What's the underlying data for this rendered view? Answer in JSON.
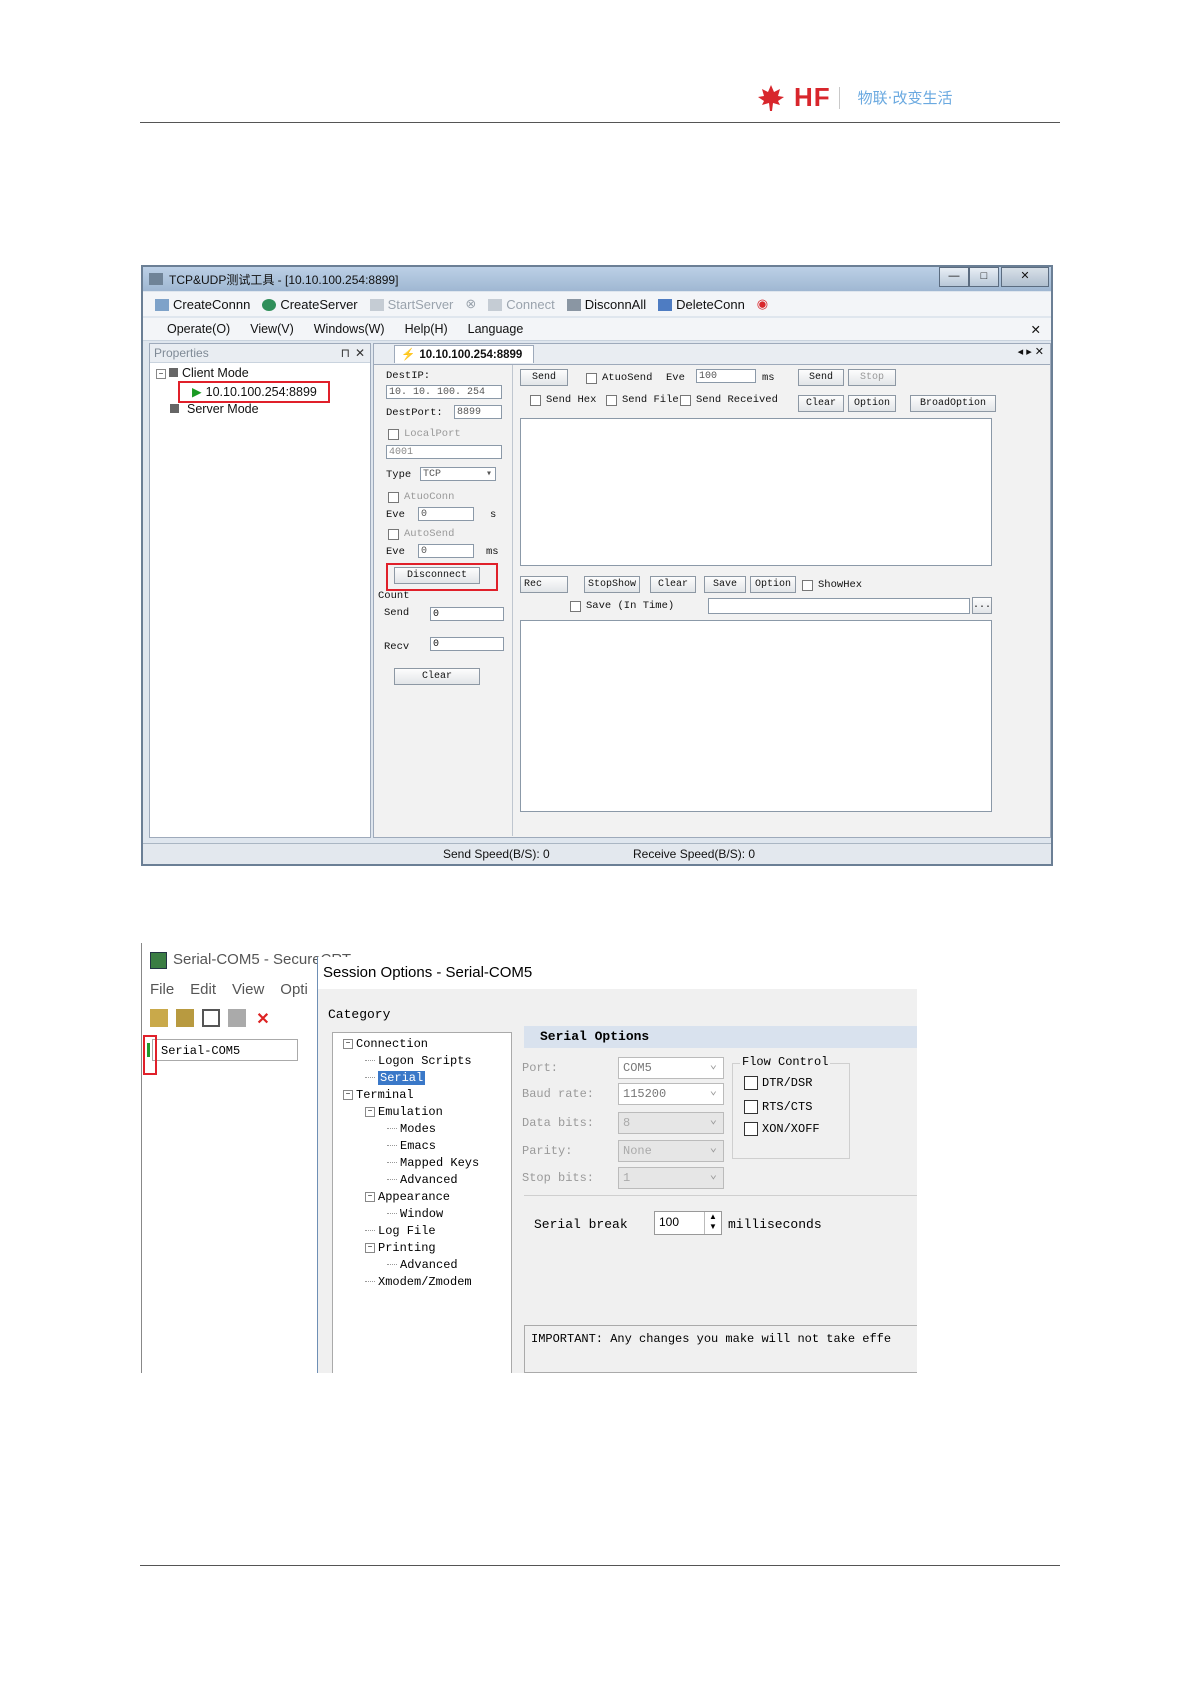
{
  "header": {
    "brand": "HF",
    "slogan": "物联·改变生活"
  },
  "tcp_tool": {
    "title": "TCP&UDP测试工具 - [10.10.100.254:8899]",
    "window_controls": [
      "—",
      "□",
      "✕"
    ],
    "toolbar": [
      "CreateConnn",
      "CreateServer",
      "StartServer",
      "Connect",
      "DisconnAll",
      "DeleteConn"
    ],
    "menu": [
      "Operate(O)",
      "View(V)",
      "Windows(W)",
      "Help(H)",
      "Language"
    ],
    "properties_label": "Properties",
    "tree": {
      "client_mode": "Client Mode",
      "connection": "10.10.100.254:8899",
      "server_mode": "Server Mode"
    },
    "tab_label": "10.10.100.254:8899",
    "left_panel": {
      "dest_ip_label": "DestIP:",
      "dest_ip_value": "10. 10. 100. 254",
      "dest_port_label": "DestPort:",
      "dest_port_value": "8899",
      "local_port_label": "LocalPort",
      "local_port_value": "4001",
      "type_label": "Type",
      "type_value": "TCP",
      "atuo_conn_label": "AtuoConn",
      "eve1_label": "Eve",
      "eve1_value": "0",
      "eve1_unit": "s",
      "auto_send_label": "AutoSend",
      "eve2_label": "Eve",
      "eve2_value": "0",
      "eve2_unit": "ms",
      "disconnect_button": "Disconnect",
      "count_label": "Count",
      "send_label": "Send",
      "send_value": "0",
      "recv_label": "Recv",
      "recv_value": "0",
      "clear_button": "Clear"
    },
    "send_bar": {
      "send_button": "Send",
      "atuo_send_label": "AtuoSend",
      "eve_label": "Eve",
      "eve_value": "100",
      "ms_label": "ms",
      "send2_button": "Send",
      "stop_button": "Stop",
      "send_hex_label": "Send Hex",
      "send_file_label": "Send File",
      "send_received_label": "Send Received",
      "clear_button": "Clear",
      "option_button": "Option",
      "broadcast_button": "BroadOption"
    },
    "recv_bar": {
      "rec_label": "Rec",
      "stopshow_button": "StopShow",
      "clear_button": "Clear",
      "save_button": "Save",
      "option_button": "Option",
      "showhex_label": "ShowHex",
      "save_realtime_label": "Save (In Time)",
      "browse_button": "..."
    },
    "status": {
      "send_speed": "Send Speed(B/S): 0",
      "receive_speed": "Receive Speed(B/S): 0"
    }
  },
  "securecrt": {
    "bg_title": "Serial-COM5 - SecureCRT",
    "bg_menu": [
      "File",
      "Edit",
      "View",
      "Opti"
    ],
    "bg_session_tab": "Serial-COM5",
    "dialog_title": "Session Options - Serial-COM5",
    "category_label": "Category",
    "tree": [
      {
        "label": "Connection",
        "level": 0,
        "expander": "-"
      },
      {
        "label": "Logon Scripts",
        "level": 1,
        "expander": ""
      },
      {
        "label": "Serial",
        "level": 1,
        "expander": "",
        "selected": true
      },
      {
        "label": "Terminal",
        "level": 0,
        "expander": "-"
      },
      {
        "label": "Emulation",
        "level": 1,
        "expander": "-"
      },
      {
        "label": "Modes",
        "level": 2,
        "expander": ""
      },
      {
        "label": "Emacs",
        "level": 2,
        "expander": ""
      },
      {
        "label": "Mapped Keys",
        "level": 2,
        "expander": ""
      },
      {
        "label": "Advanced",
        "level": 2,
        "expander": ""
      },
      {
        "label": "Appearance",
        "level": 1,
        "expander": "-"
      },
      {
        "label": "Window",
        "level": 2,
        "expander": ""
      },
      {
        "label": "Log File",
        "level": 1,
        "expander": ""
      },
      {
        "label": "Printing",
        "level": 1,
        "expander": "-"
      },
      {
        "label": "Advanced",
        "level": 2,
        "expander": ""
      },
      {
        "label": "Xmodem/Zmodem",
        "level": 1,
        "expander": ""
      }
    ],
    "serial_options_title": "Serial Options",
    "port_label": "Port:",
    "port_value": "COM5",
    "baud_label": "Baud rate:",
    "baud_value": "115200",
    "data_bits_label": "Data bits:",
    "data_bits_value": "8",
    "parity_label": "Parity:",
    "parity_value": "None",
    "stop_bits_label": "Stop bits:",
    "stop_bits_value": "1",
    "flow_control_label": "Flow Control",
    "flow_dtr": "DTR/DSR",
    "flow_rts": "RTS/CTS",
    "flow_xon": "XON/XOFF",
    "serial_break_label": "Serial break",
    "serial_break_value": "100",
    "milliseconds_label": "milliseconds",
    "important_text": "IMPORTANT: Any changes you make will not take effe"
  }
}
